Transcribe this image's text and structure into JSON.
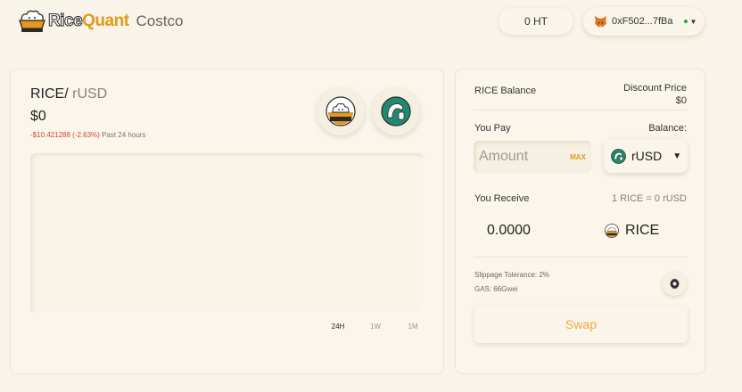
{
  "header": {
    "brand_part1": "Rice",
    "brand_part2": "Quant",
    "brand_sub": "Costco",
    "ht_balance": "0 HT",
    "wallet_address": "0xF502...7fBa"
  },
  "market": {
    "pair_base": "RICE/",
    "pair_quote": "rUSD",
    "price": "$0",
    "change_value": "-$10.421288 (-2.63%)",
    "change_period": "Past 24 hours",
    "ranges": [
      "24H",
      "1W",
      "1M"
    ],
    "active_range": "24H"
  },
  "swap": {
    "balance_label": "RICE Balance",
    "discount_label": "Discount Price",
    "discount_value": "$0",
    "pay_label": "You Pay",
    "pay_balance_label": "Balance:",
    "amount_placeholder": "Amount",
    "max_label": "MAX",
    "pay_token": "rUSD",
    "receive_label": "You Receive",
    "rate": "1 RICE = 0 rUSD",
    "receive_amount": "0.0000",
    "receive_token": "RICE",
    "slippage": "Slippage Tolerance: 2%",
    "gas": "GAS: 66Gwei",
    "swap_label": "Swap"
  },
  "colors": {
    "background": "#f9f4e9",
    "accent": "#e39a1b",
    "negative": "#d0452e",
    "rusd_green": "#1f8a70"
  }
}
